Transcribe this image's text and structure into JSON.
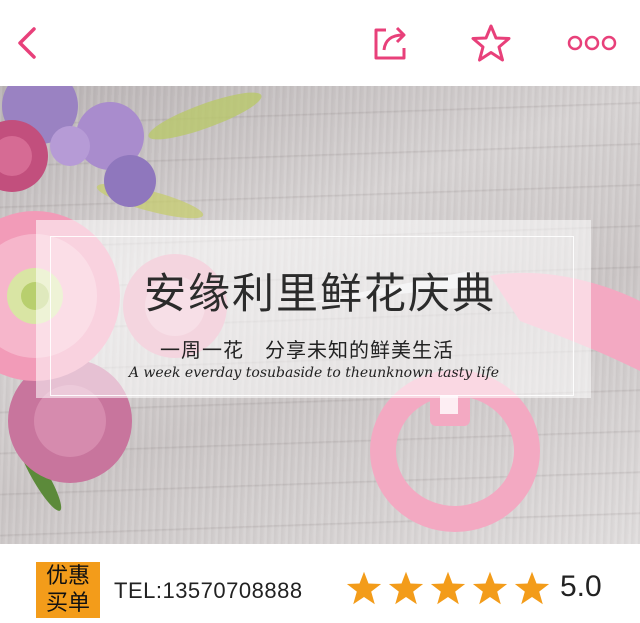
{
  "topbar": {
    "back_icon": "chevron-left-icon",
    "share_icon": "share-icon",
    "favorite_icon": "star-outline-icon",
    "more_icon": "more-dots-icon",
    "accent_color": "#e8407a"
  },
  "banner": {
    "title": "安缘利里鲜花庆典",
    "subtitle": "一周一花　分享未知的鲜美生活",
    "script_line": "A week everday tosubaside to theunknown tasty life"
  },
  "bottombar": {
    "badge_line1": "优惠",
    "badge_line2": "买单",
    "phone": "TEL:13570708888",
    "rating_stars": 5,
    "rating_value": "5.0",
    "star_color": "#f39c1a"
  }
}
